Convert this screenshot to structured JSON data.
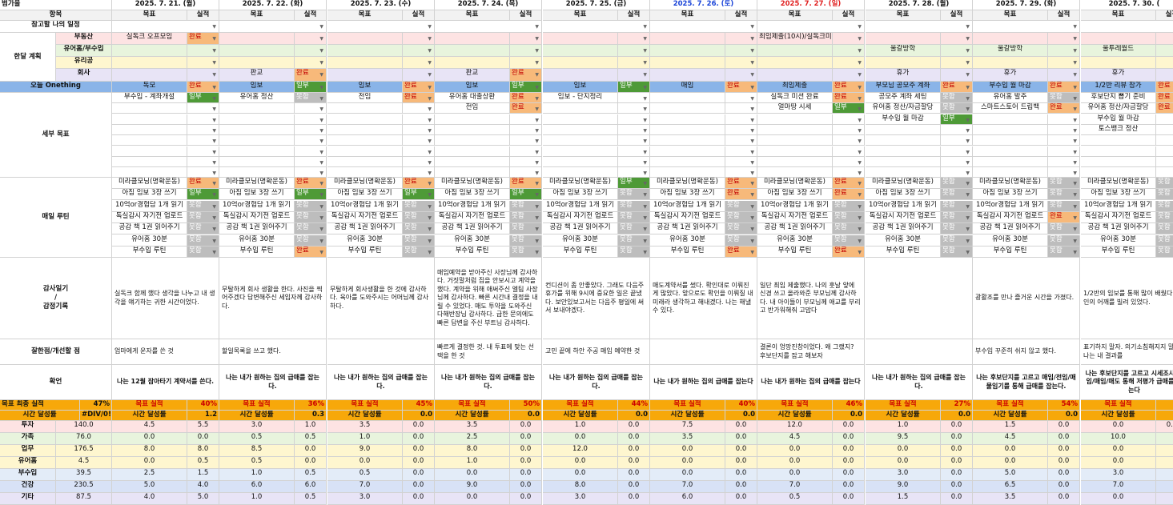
{
  "colors": {
    "accent": "#f7a80a",
    "pink": "#fde3e3",
    "green": "#e8f4dd",
    "yellow": "#fef6cf",
    "lavender": "#e8e4f6",
    "onething": "#8ab4e8",
    "orange_badge": "#f7b97a",
    "green_badge": "#4e9a37",
    "gray_badge": "#bdbdbd",
    "blue_date": "#1a44d8",
    "red_date": "#e02020"
  },
  "header": {
    "corner": "범가을",
    "dates": [
      "2025. 7. 21. (월)",
      "2025. 7. 22. (화)",
      "2025. 7. 23. (수)",
      "2025. 7. 24. (목)",
      "2025. 7. 25. (금)",
      "2025. 7. 26. (토)",
      "2025. 7. 27. (일)",
      "2025. 7. 28. (월)",
      "2025. 7. 29. (화)",
      "2025. 7. 30. ("
    ]
  },
  "columns": {
    "item": "항목",
    "goal": "목표",
    "done": "실적"
  },
  "labels": {
    "schedule": "참고할 나의 일정",
    "month_plan": "한달 계획",
    "realestate": "부동산",
    "youtube": "유어홈/부수입",
    "glass": "유리공",
    "company": "회사",
    "onething": "오늘 Onething",
    "detail": "세부 목표",
    "routine": "매일 루틴",
    "gratitude": "감사일기\n/\n감정기록",
    "review": "잘한점/개선할 점",
    "affirm": "확언",
    "final": "목표 최종 실적",
    "time": "시간 달성률"
  },
  "plan": {
    "realestate": [
      "실독크 오프모임",
      "",
      "",
      "",
      "",
      "",
      "최임제출(10시)/실독크미션",
      "",
      "",
      ""
    ],
    "realestate_status": "완료",
    "youtube": [
      "",
      "",
      "",
      "",
      "",
      "",
      "",
      "울갈방학",
      "울갈방학",
      "울투레월드"
    ],
    "company": [
      "",
      "판교",
      "",
      "판교",
      "",
      "",
      "",
      "휴가",
      "휴가",
      "휴가"
    ],
    "company_status": "완료"
  },
  "onething": {
    "goals": [
      "독모",
      "임보",
      "임보",
      "임보",
      "임보",
      "매임",
      "최임제출",
      "부모님 공모주 계좌",
      "부수입 월 마감",
      "1/2반 리뷰 참가"
    ],
    "status": [
      "완료",
      "일부",
      "완료",
      "일부",
      "일부",
      "완료",
      "완료",
      "완료",
      "완료",
      "완료"
    ]
  },
  "detail_rows": [
    {
      "goals": [
        "부수입 - 계좌개설",
        "유어홈 정산",
        "전임",
        "유어홈 대출상환",
        "임보 - 단지정리",
        "",
        "실독크 미션 완료",
        "공모주 계좌 세팅",
        "유어홈 발주",
        "후보단지 뽑기 준비"
      ],
      "status": [
        "일부",
        "못함",
        "완료",
        "완료",
        "",
        "",
        "완료",
        "못함",
        "못함",
        "완료"
      ]
    },
    {
      "goals": [
        "",
        "",
        "",
        "전임",
        "",
        "",
        "얼마땅 시세",
        "유어홈 정산/자금할당",
        "스마트스토어 드립백",
        "유어홈 정산/자금할당"
      ],
      "status": [
        "",
        "",
        "",
        "완료",
        "",
        "",
        "일부",
        "못함",
        "완료",
        "완료"
      ]
    },
    {
      "goals": [
        "",
        "",
        "",
        "",
        "",
        "",
        "",
        "부수입 월 마감",
        "",
        "부수입 월 마감"
      ],
      "status": [
        "",
        "",
        "",
        "",
        "",
        "",
        "",
        "일부",
        "",
        ""
      ]
    },
    {
      "goals": [
        "",
        "",
        "",
        "",
        "",
        "",
        "",
        "",
        "",
        "토스뱅크 정산"
      ],
      "status": [
        "",
        "",
        "",
        "",
        "",
        "",
        "",
        "",
        "",
        ""
      ]
    }
  ],
  "routines": [
    {
      "name": "미라클모닝(명확운동)",
      "status": [
        "완료",
        "완료",
        "완료",
        "완료",
        "일부",
        "완료",
        "완료",
        "못함",
        "못함",
        "못함"
      ]
    },
    {
      "name": "아침 임보 3장 쓰기",
      "status": [
        "일부",
        "일부",
        "일부",
        "일부",
        "못함",
        "완료",
        "완료",
        "못함",
        "못함",
        "못함"
      ]
    },
    {
      "name": "10억or경험담 1개 읽기",
      "status": [
        "못함",
        "못함",
        "못함",
        "못함",
        "못함",
        "못함",
        "못함",
        "못함",
        "못함",
        "못함"
      ]
    },
    {
      "name": "독실감시 자기전 업로드",
      "status": [
        "못함",
        "못함",
        "못함",
        "못함",
        "못함",
        "못함",
        "못함",
        "못함",
        "완료",
        "못함"
      ]
    },
    {
      "name": "공감 책 1권 읽어주기",
      "status": [
        "못함",
        "못함",
        "못함",
        "못함",
        "못함",
        "못함",
        "못함",
        "못함",
        "못함",
        "못함"
      ]
    },
    {
      "name": "유어홈 30분",
      "status": [
        "못함",
        "못함",
        "못함",
        "못함",
        "못함",
        "못함",
        "못함",
        "못함",
        "못함",
        "못함"
      ]
    },
    {
      "name": "부수입 루틴",
      "status": [
        "못함",
        "완료",
        "못함",
        "못함",
        "못함",
        "완료",
        "완료",
        "못함",
        "못함",
        "못함"
      ]
    }
  ],
  "gratitude": [
    "실독크 함께 했다 생각을 나누고 내 생각을 얘기하는 귀한 시간이었다.",
    "무탈하게 회사 생활을 한다. 사진을 찍어주겠다 답변해주신 세입자께 감사하다.",
    "무탈하게 회사생활을 한 것에 감사하다. 육아를 도와주시는 어머님께 감사하다.",
    "매임예약을 받아주신 사장님께 감사하다. 거짓말처럼 집을 안보시고 계약을 했다. 계약을 위해 애써주신 엘팀 사장님께 감사하다. 빠른 시간내 결정을 내릴 수 있었다. 매도 투약을 도와주신 다해반장님 감사하다. 급한 문의에도 빠른 답변을 주신 부트님 감사하다.",
    "컨디션이 좀 안좋았다. 그래도 다음주 휴가를 위해 9시에 중요한 일은 끝냈다. 보안있보고서는 다음주 평일에 써서 보내야겠다.",
    "매도계약서를 썼다. 확인대로 이뤄진게 많았다. 앞으로도 확인을 이뤄질 내 미래라 생각하고 해내겠다. 나는 해낼 수 있다.",
    "일단 최임 제출했다. 나의 훗날 앞에 신경 쓰고 올라와준 부모님께 감사하다. 내 아이들이 부모님께 애교를 부리고 반가워해줘 고맙다",
    "",
    "광활조를 만나 즐거운 시간을 가졌다.",
    "1/2반의 임보를 통해 많이 배웠다. 거인의 어깨를 빌려 있었다."
  ],
  "review": [
    "엄마에게 운자를 쓴 것",
    "할일목록을 쓰고 했다.",
    "",
    "빠르게 결정한 것. 내 투표에 맞는 선택을 한 것",
    "고민 끝에 하안 주공 매임 예약한 것",
    "",
    "결론이 엉망진창이었다. 왜 그랬지? 후보단지를 잡고 해보자",
    "",
    "부수입 꾸준히 쉬지 않고 했다.",
    "표기하지 말자. 의기소침해지지 말자. 나는 내 결과를"
  ],
  "affirm": [
    "나는 12월 잠아타기 계약서를 쓴다.",
    "나는 내가 원하는 집의 급매를 잡는다.",
    "나는 내가 원하는 집의 급매를 잡는다.",
    "나는 내가 원하는 집의 급매를 잡는다.",
    "나는 내가 원하는 집의 급매를 잡는다.",
    "나는 내가 원하는 집의 급매를 잡는다",
    "나는 내가 원하는 집의 급매를 잡는다",
    "나는 내가 원하는 집의 급매를 잡는다.",
    "나는 후보단지를 고르고 매임/전임/매물임기를 통해 급매를 잡는다.",
    "나는 후보단지를 고르고 시세조사/전임/매임/매도 통해 저평가 급매를 잡는다"
  ],
  "final": {
    "label": "목표 실적",
    "first_pct": "47%",
    "pcts": [
      "40%",
      "36%",
      "45%",
      "50%",
      "44%",
      "40%",
      "46%",
      "27%",
      "54%",
      ""
    ]
  },
  "time": {
    "label": "시간 달성률",
    "first": "#DIV/0!",
    "vals": [
      "1.2",
      "0.3",
      "0.0",
      "0.0",
      "0.0",
      "0.0",
      "0.0",
      "0.0",
      "0.0",
      ""
    ]
  },
  "categories": [
    {
      "name": "투자",
      "total": "140.0",
      "color": "#fde3e3",
      "goal": [
        "4.5",
        "3.0",
        "3.5",
        "3.5",
        "1.0",
        "7.5",
        "12.0",
        "1.0",
        "1.5",
        "0.0"
      ],
      "done": [
        "5.5",
        "1.0",
        "0.0",
        "0.0",
        "0.0",
        "0.0",
        "0.0",
        "0.0",
        "0.0",
        "0.0"
      ]
    },
    {
      "name": "가족",
      "total": "76.0",
      "color": "#e8f4dd",
      "goal": [
        "0.0",
        "0.5",
        "1.0",
        "2.5",
        "0.0",
        "3.5",
        "4.5",
        "9.5",
        "4.5",
        "10.0"
      ],
      "done": [
        "0.0",
        "0.5",
        "0.0",
        "0.0",
        "0.0",
        "0.0",
        "0.0",
        "0.0",
        "0.0",
        ""
      ]
    },
    {
      "name": "업무",
      "total": "176.5",
      "color": "#fef6cf",
      "goal": [
        "8.0",
        "8.5",
        "9.0",
        "8.0",
        "12.0",
        "0.0",
        "0.0",
        "0.0",
        "0.0",
        "0.0"
      ],
      "done": [
        "8.0",
        "0.0",
        "0.0",
        "0.0",
        "0.0",
        "0.0",
        "0.0",
        "0.0",
        "0.0",
        ""
      ]
    },
    {
      "name": "유어홈",
      "total": "4.5",
      "color": "#fef6cf",
      "goal": [
        "0.0",
        "0.5",
        "0.0",
        "1.0",
        "0.0",
        "0.0",
        "0.0",
        "0.0",
        "0.0",
        "0.0"
      ],
      "done": [
        "0.5",
        "0.0",
        "0.0",
        "0.0",
        "0.0",
        "0.0",
        "0.0",
        "0.0",
        "0.0",
        ""
      ]
    },
    {
      "name": "부수입",
      "total": "39.5",
      "color": "#e3ecf8",
      "goal": [
        "2.5",
        "1.0",
        "0.5",
        "0.0",
        "0.0",
        "0.0",
        "0.0",
        "3.0",
        "5.0",
        "3.0"
      ],
      "done": [
        "1.5",
        "0.5",
        "0.0",
        "0.0",
        "0.0",
        "0.0",
        "0.0",
        "0.0",
        "0.0",
        ""
      ]
    },
    {
      "name": "건강",
      "total": "230.5",
      "color": "#d8e2f6",
      "goal": [
        "5.0",
        "6.0",
        "7.0",
        "9.0",
        "8.0",
        "7.0",
        "7.0",
        "9.0",
        "6.5",
        "7.0"
      ],
      "done": [
        "4.0",
        "6.0",
        "0.0",
        "0.0",
        "0.0",
        "0.0",
        "0.0",
        "0.0",
        "0.0",
        ""
      ]
    },
    {
      "name": "기타",
      "total": "87.5",
      "color": "#e8e4f6",
      "goal": [
        "4.0",
        "1.0",
        "3.0",
        "0.0",
        "3.0",
        "6.0",
        "0.5",
        "1.5",
        "3.5",
        "0.0"
      ],
      "done": [
        "5.0",
        "0.5",
        "0.0",
        "0.0",
        "0.0",
        "0.0",
        "0.0",
        "0.0",
        "0.0",
        ""
      ]
    }
  ]
}
